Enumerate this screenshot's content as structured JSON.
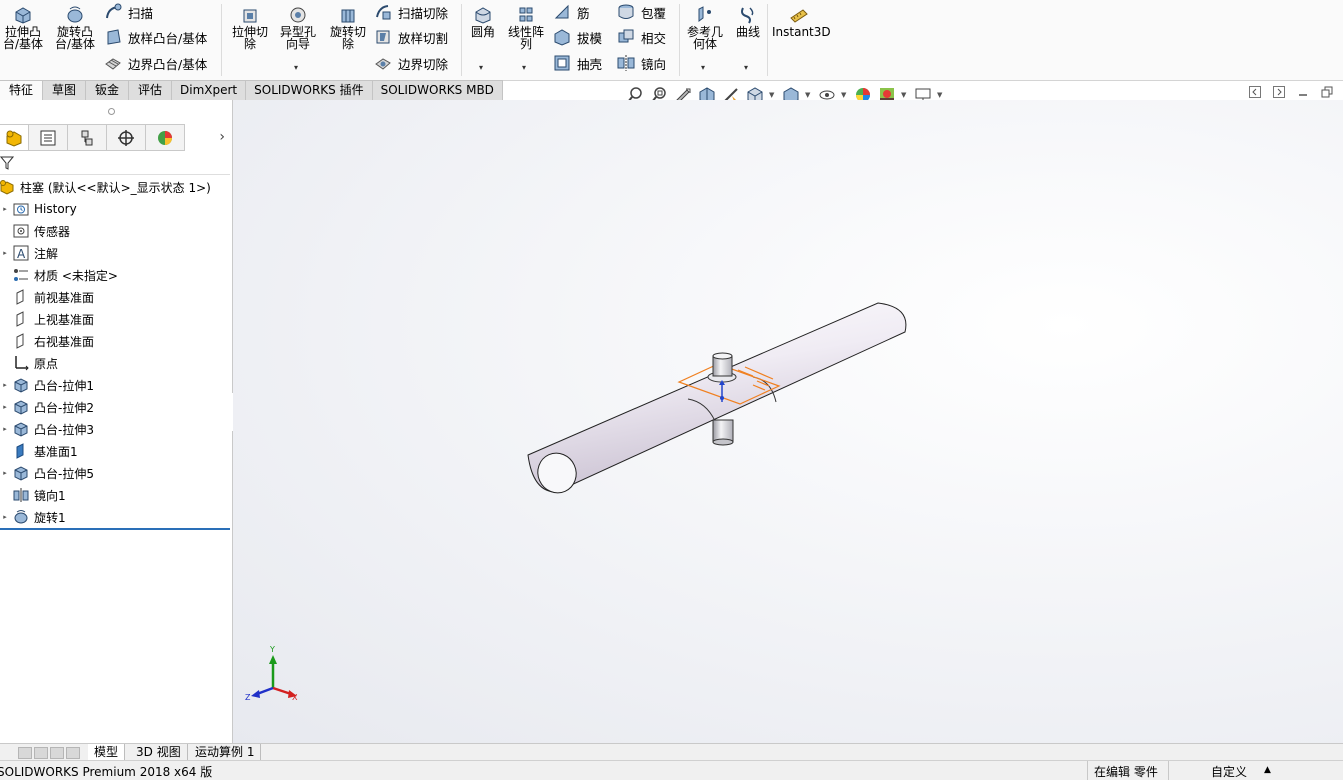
{
  "ribbon": {
    "extrude_boss": "拉伸凸\n台/基体",
    "revolve_boss": "旋转凸\n台/基体",
    "sweep": "扫描",
    "loft_boss": "放样凸台/基体",
    "boundary_boss": "边界凸台/基体",
    "extrude_cut": "拉伸切\n除",
    "hole_wizard": "异型孔\n向导",
    "revolve_cut": "旋转切\n除",
    "sweep_cut": "扫描切除",
    "loft_cut": "放样切割",
    "boundary_cut": "边界切除",
    "fillet": "圆角",
    "linear_pattern": "线性阵\n列",
    "rib": "筋",
    "draft": "拔模",
    "shell": "抽壳",
    "wrap": "包覆",
    "intersect": "相交",
    "mirror": "镜向",
    "reference_geometry": "参考几\n何体",
    "curves": "曲线",
    "instant3d": "Instant3D"
  },
  "command_tabs": [
    "特征",
    "草图",
    "钣金",
    "评估",
    "DimXpert",
    "SOLIDWORKS 插件",
    "SOLIDWORKS MBD"
  ],
  "tree": {
    "root": "柱塞  (默认<<默认>_显示状态 1>)",
    "items": [
      {
        "label": "History",
        "icon": "folder-history-icon",
        "expand": true
      },
      {
        "label": "传感器",
        "icon": "sensor-icon",
        "expand": false
      },
      {
        "label": "注解",
        "icon": "annotation-icon",
        "expand": true
      },
      {
        "label": "材质 <未指定>",
        "icon": "material-icon",
        "expand": false
      },
      {
        "label": "前视基准面",
        "icon": "plane-icon",
        "expand": false
      },
      {
        "label": "上视基准面",
        "icon": "plane-icon",
        "expand": false
      },
      {
        "label": "右视基准面",
        "icon": "plane-icon",
        "expand": false
      },
      {
        "label": "原点",
        "icon": "origin-icon",
        "expand": false
      },
      {
        "label": "凸台-拉伸1",
        "icon": "extrude-feature-icon",
        "expand": true
      },
      {
        "label": "凸台-拉伸2",
        "icon": "extrude-feature-icon",
        "expand": true
      },
      {
        "label": "凸台-拉伸3",
        "icon": "extrude-feature-icon",
        "expand": true
      },
      {
        "label": "基准面1",
        "icon": "plane-solid-icon",
        "expand": false
      },
      {
        "label": "凸台-拉伸5",
        "icon": "extrude-feature-icon",
        "expand": true
      },
      {
        "label": "镜向1",
        "icon": "mirror-feature-icon",
        "expand": false
      },
      {
        "label": "旋转1",
        "icon": "revolve-feature-icon",
        "expand": true
      }
    ]
  },
  "triad": {
    "x": "X",
    "y": "Y",
    "z": "Z"
  },
  "bottom_tabs": [
    "模型",
    "3D 视图",
    "运动算例 1"
  ],
  "status": {
    "product": "SOLIDWORKS Premium 2018 x64 版",
    "editing": "在编辑 零件",
    "custom": "自定义"
  },
  "colors": {
    "accent": "#2a6fb8",
    "sketch": "#f08020",
    "part": "#e9e4ee"
  }
}
